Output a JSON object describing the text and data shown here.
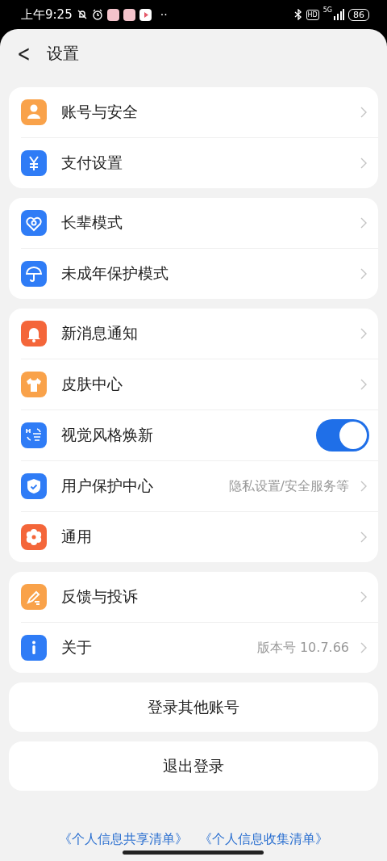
{
  "status_bar": {
    "time": "上午9:25",
    "more": "··",
    "hd": "HD",
    "network": "5G",
    "battery": "86"
  },
  "header": {
    "back": "<",
    "title": "设置"
  },
  "groups": [
    {
      "items": [
        {
          "kind": "link",
          "label": "账号与安全",
          "color": "#f9a24a"
        },
        {
          "kind": "link",
          "label": "支付设置",
          "color": "#2f7cf6"
        }
      ]
    },
    {
      "items": [
        {
          "kind": "link",
          "label": "长辈模式",
          "color": "#2f7cf6"
        },
        {
          "kind": "link",
          "label": "未成年保护模式",
          "color": "#2f7cf6"
        }
      ]
    },
    {
      "items": [
        {
          "kind": "link",
          "label": "新消息通知",
          "color": "#f4663a"
        },
        {
          "kind": "link",
          "label": "皮肤中心",
          "color": "#f9a24a"
        },
        {
          "kind": "toggle",
          "label": "视觉风格焕新",
          "color": "#2f7cf6",
          "on": true
        },
        {
          "kind": "link",
          "label": "用户保护中心",
          "value": "隐私设置/安全服务等",
          "color": "#2f7cf6"
        },
        {
          "kind": "link",
          "label": "通用",
          "color": "#f4663a"
        }
      ]
    },
    {
      "items": [
        {
          "kind": "link",
          "label": "反馈与投诉",
          "color": "#f9a24a"
        },
        {
          "kind": "link",
          "label": "关于",
          "value": "版本号 10.7.66",
          "color": "#2f7cf6"
        }
      ]
    }
  ],
  "buttons": [
    "登录其他账号",
    "退出登录"
  ],
  "footer_links": [
    "《个人信息共享清单》",
    "《个人信息收集清单》"
  ]
}
